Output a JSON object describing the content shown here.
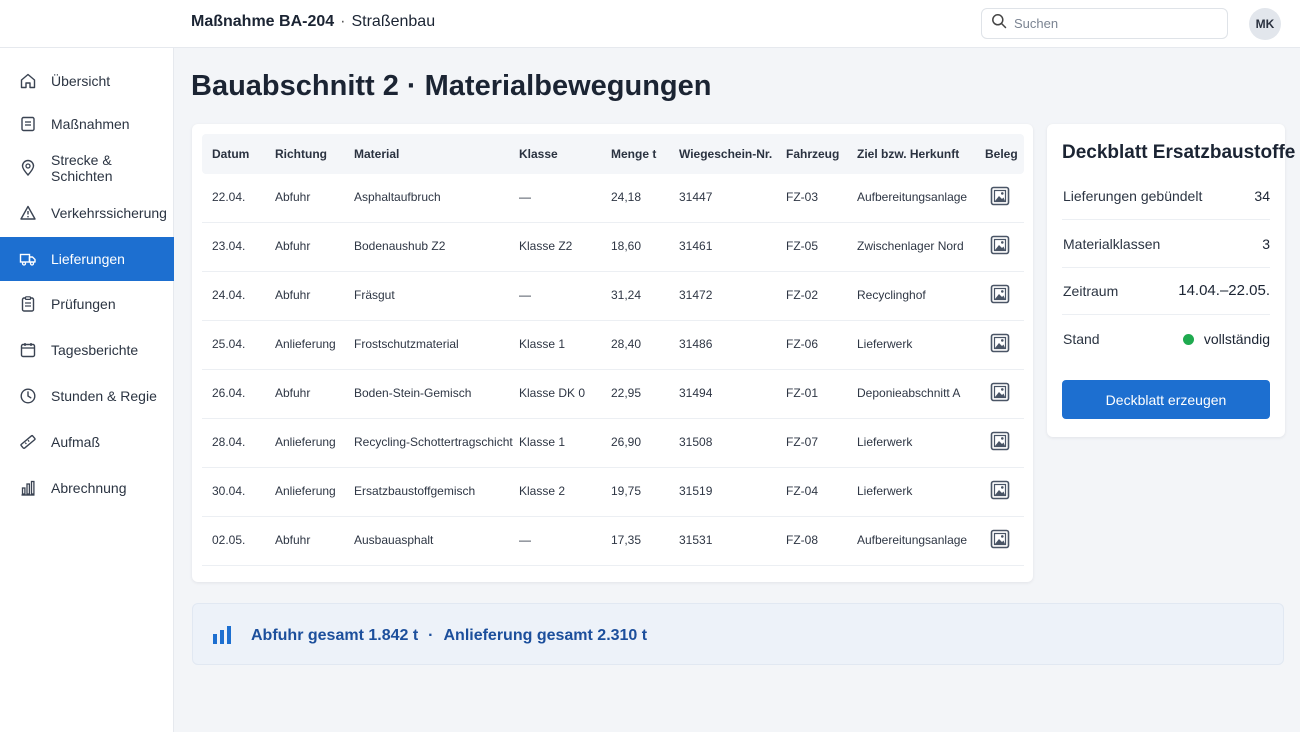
{
  "header": {
    "project": "Maßnahme BA-204",
    "separator": "·",
    "category": "Straßenbau",
    "search_placeholder": "Suchen",
    "avatar_initials": "MK"
  },
  "sidebar": {
    "items": [
      {
        "label": "Übersicht",
        "icon": "home-icon",
        "active": false
      },
      {
        "label": "Maßnahmen",
        "icon": "document-icon",
        "active": false
      },
      {
        "label": "Strecke & Schichten",
        "icon": "map-pin-icon",
        "active": false
      },
      {
        "label": "Verkehrssicherung",
        "icon": "warning-icon",
        "active": false
      },
      {
        "label": "Lieferungen",
        "icon": "truck-icon",
        "active": true
      },
      {
        "label": "Prüfungen",
        "icon": "clipboard-icon",
        "active": false
      },
      {
        "label": "Tagesberichte",
        "icon": "calendar-icon",
        "active": false
      },
      {
        "label": "Stunden & Regie",
        "icon": "clock-icon",
        "active": false
      },
      {
        "label": "Aufmaß",
        "icon": "ruler-icon",
        "active": false
      },
      {
        "label": "Abrechnung",
        "icon": "bar-chart-icon",
        "active": false
      }
    ]
  },
  "page": {
    "title": "Bauabschnitt 2 · Materialbewegungen"
  },
  "table": {
    "columns": [
      "Datum",
      "Richtung",
      "Material",
      "Klasse",
      "Menge t",
      "Wiegeschein-Nr.",
      "Fahrzeug",
      "Ziel bzw. Herkunft",
      "Beleg"
    ],
    "rows": [
      {
        "datum": "22.04.",
        "richtung": "Abfuhr",
        "material": "Asphaltaufbruch",
        "klasse": "—",
        "menge": "24,18",
        "wiegeschein": "31447",
        "fahrzeug": "FZ-03",
        "ziel": "Aufbereitungsanlage"
      },
      {
        "datum": "23.04.",
        "richtung": "Abfuhr",
        "material": "Bodenaushub Z2",
        "klasse": "Klasse Z2",
        "menge": "18,60",
        "wiegeschein": "31461",
        "fahrzeug": "FZ-05",
        "ziel": "Zwischenlager Nord"
      },
      {
        "datum": "24.04.",
        "richtung": "Abfuhr",
        "material": "Fräsgut",
        "klasse": "—",
        "menge": "31,24",
        "wiegeschein": "31472",
        "fahrzeug": "FZ-02",
        "ziel": "Recyclinghof"
      },
      {
        "datum": "25.04.",
        "richtung": "Anlieferung",
        "material": "Frostschutzmaterial",
        "klasse": "Klasse 1",
        "menge": "28,40",
        "wiegeschein": "31486",
        "fahrzeug": "FZ-06",
        "ziel": "Lieferwerk"
      },
      {
        "datum": "26.04.",
        "richtung": "Abfuhr",
        "material": "Boden-Stein-Gemisch",
        "klasse": "Klasse DK 0",
        "menge": "22,95",
        "wiegeschein": "31494",
        "fahrzeug": "FZ-01",
        "ziel": "Deponieabschnitt A"
      },
      {
        "datum": "28.04.",
        "richtung": "Anlieferung",
        "material": "Recycling-Schottertragschicht",
        "klasse": "Klasse 1",
        "menge": "26,90",
        "wiegeschein": "31508",
        "fahrzeug": "FZ-07",
        "ziel": "Lieferwerk"
      },
      {
        "datum": "30.04.",
        "richtung": "Anlieferung",
        "material": "Ersatzbaustoffgemisch",
        "klasse": "Klasse 2",
        "menge": "19,75",
        "wiegeschein": "31519",
        "fahrzeug": "FZ-04",
        "ziel": "Lieferwerk"
      },
      {
        "datum": "02.05.",
        "richtung": "Abfuhr",
        "material": "Ausbauasphalt",
        "klasse": "—",
        "menge": "17,35",
        "wiegeschein": "31531",
        "fahrzeug": "FZ-08",
        "ziel": "Aufbereitungsanlage"
      }
    ],
    "beleg_icon": "image-icon"
  },
  "summary": {
    "title": "Deckblatt Ersatzbaustoffe",
    "rows": [
      {
        "label": "Lieferungen gebündelt",
        "value": "34"
      },
      {
        "label": "Materialklassen",
        "value": "3"
      },
      {
        "label": "Zeitraum",
        "value": "14.04.–22.05."
      },
      {
        "label": "Stand",
        "value": "vollständig"
      }
    ],
    "status_color": "#1faa4f",
    "button_label": "Deckblatt erzeugen"
  },
  "footer": {
    "abfuhr": "Abfuhr gesamt 1.842 t",
    "separator": "·",
    "anlieferung": "Anlieferung gesamt 2.310 t",
    "icon": "bar-chart-icon"
  },
  "colors": {
    "accent": "#1d6fd0",
    "footer_text": "#1c4f9c",
    "status_ok": "#1faa4f"
  }
}
